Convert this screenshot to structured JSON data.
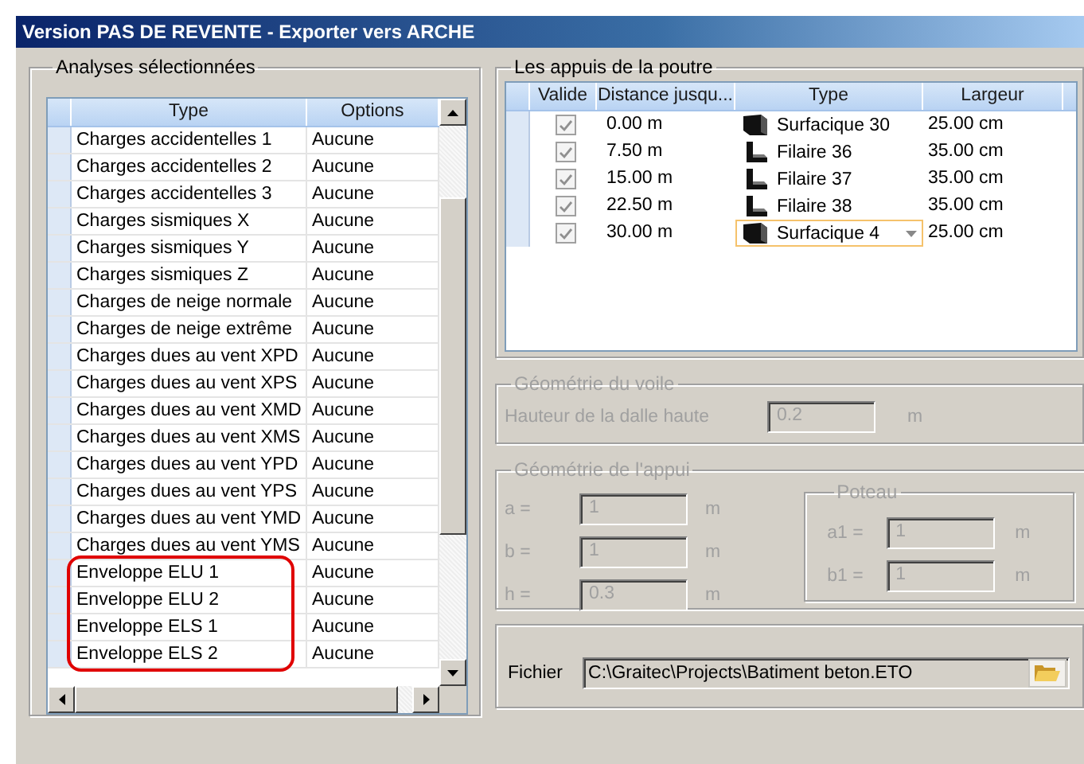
{
  "window": {
    "title": "Version PAS DE REVENTE - Exporter vers ARCHE"
  },
  "analyses": {
    "title": "Analyses sélectionnées",
    "columns": [
      "Type",
      "Options"
    ],
    "rows": [
      {
        "type": "Charges accidentelles 1",
        "options": "Aucune",
        "circled": false
      },
      {
        "type": "Charges accidentelles 2",
        "options": "Aucune",
        "circled": false
      },
      {
        "type": "Charges accidentelles 3",
        "options": "Aucune",
        "circled": false
      },
      {
        "type": "Charges sismiques X",
        "options": "Aucune",
        "circled": false
      },
      {
        "type": "Charges sismiques Y",
        "options": "Aucune",
        "circled": false
      },
      {
        "type": "Charges sismiques Z",
        "options": "Aucune",
        "circled": false
      },
      {
        "type": "Charges de neige normale",
        "options": "Aucune",
        "circled": false
      },
      {
        "type": "Charges de neige extrême",
        "options": "Aucune",
        "circled": false
      },
      {
        "type": "Charges dues au vent XPD",
        "options": "Aucune",
        "circled": false
      },
      {
        "type": "Charges dues au vent XPS",
        "options": "Aucune",
        "circled": false
      },
      {
        "type": "Charges dues au vent XMD",
        "options": "Aucune",
        "circled": false
      },
      {
        "type": "Charges dues au vent XMS",
        "options": "Aucune",
        "circled": false
      },
      {
        "type": "Charges dues au vent YPD",
        "options": "Aucune",
        "circled": false
      },
      {
        "type": "Charges dues au vent YPS",
        "options": "Aucune",
        "circled": false
      },
      {
        "type": "Charges dues au vent YMD",
        "options": "Aucune",
        "circled": false
      },
      {
        "type": "Charges dues au vent YMS",
        "options": "Aucune",
        "circled": false
      },
      {
        "type": "Enveloppe ELU 1",
        "options": "Aucune",
        "circled": true
      },
      {
        "type": "Enveloppe ELU 2",
        "options": "Aucune",
        "circled": true
      },
      {
        "type": "Enveloppe ELS 1",
        "options": "Aucune",
        "circled": true
      },
      {
        "type": "Enveloppe ELS 2",
        "options": "Aucune",
        "circled": true
      }
    ]
  },
  "supports": {
    "title": "Les appuis de la poutre",
    "columns": [
      "Valide",
      "Distance jusqu...",
      "Type",
      "Largeur"
    ],
    "rows": [
      {
        "valid": true,
        "distance": "0.00 m",
        "kind": "surface",
        "type": "Surfacique 30",
        "width": "25.00 cm",
        "editing": false
      },
      {
        "valid": true,
        "distance": "7.50 m",
        "kind": "wire",
        "type": "Filaire 36",
        "width": "35.00 cm",
        "editing": false
      },
      {
        "valid": true,
        "distance": "15.00 m",
        "kind": "wire",
        "type": "Filaire 37",
        "width": "35.00 cm",
        "editing": false
      },
      {
        "valid": true,
        "distance": "22.50 m",
        "kind": "wire",
        "type": "Filaire 38",
        "width": "35.00 cm",
        "editing": false
      },
      {
        "valid": true,
        "distance": "30.00 m",
        "kind": "surface",
        "type": "Surfacique 4",
        "width": "25.00 cm",
        "editing": true
      }
    ]
  },
  "wall_geometry": {
    "title": "Géométrie du voile",
    "disabled": true,
    "fields": [
      {
        "label": "Hauteur de la dalle haute",
        "value": "0.2",
        "unit": "m"
      }
    ]
  },
  "support_geometry": {
    "title": "Géométrie de l'appui",
    "disabled": true,
    "fields": [
      {
        "label": "a =",
        "value": "1",
        "unit": "m"
      },
      {
        "label": "b =",
        "value": "1",
        "unit": "m"
      },
      {
        "label": "h =",
        "value": "0.3",
        "unit": "m"
      }
    ],
    "column": {
      "title": "Poteau",
      "fields": [
        {
          "label": "a1 =",
          "value": "1",
          "unit": "m"
        },
        {
          "label": "b1 =",
          "value": "1",
          "unit": "m"
        }
      ]
    }
  },
  "file": {
    "label": "Fichier",
    "value": "C:\\Graitec\\Projects\\Batiment beton.ETO"
  }
}
